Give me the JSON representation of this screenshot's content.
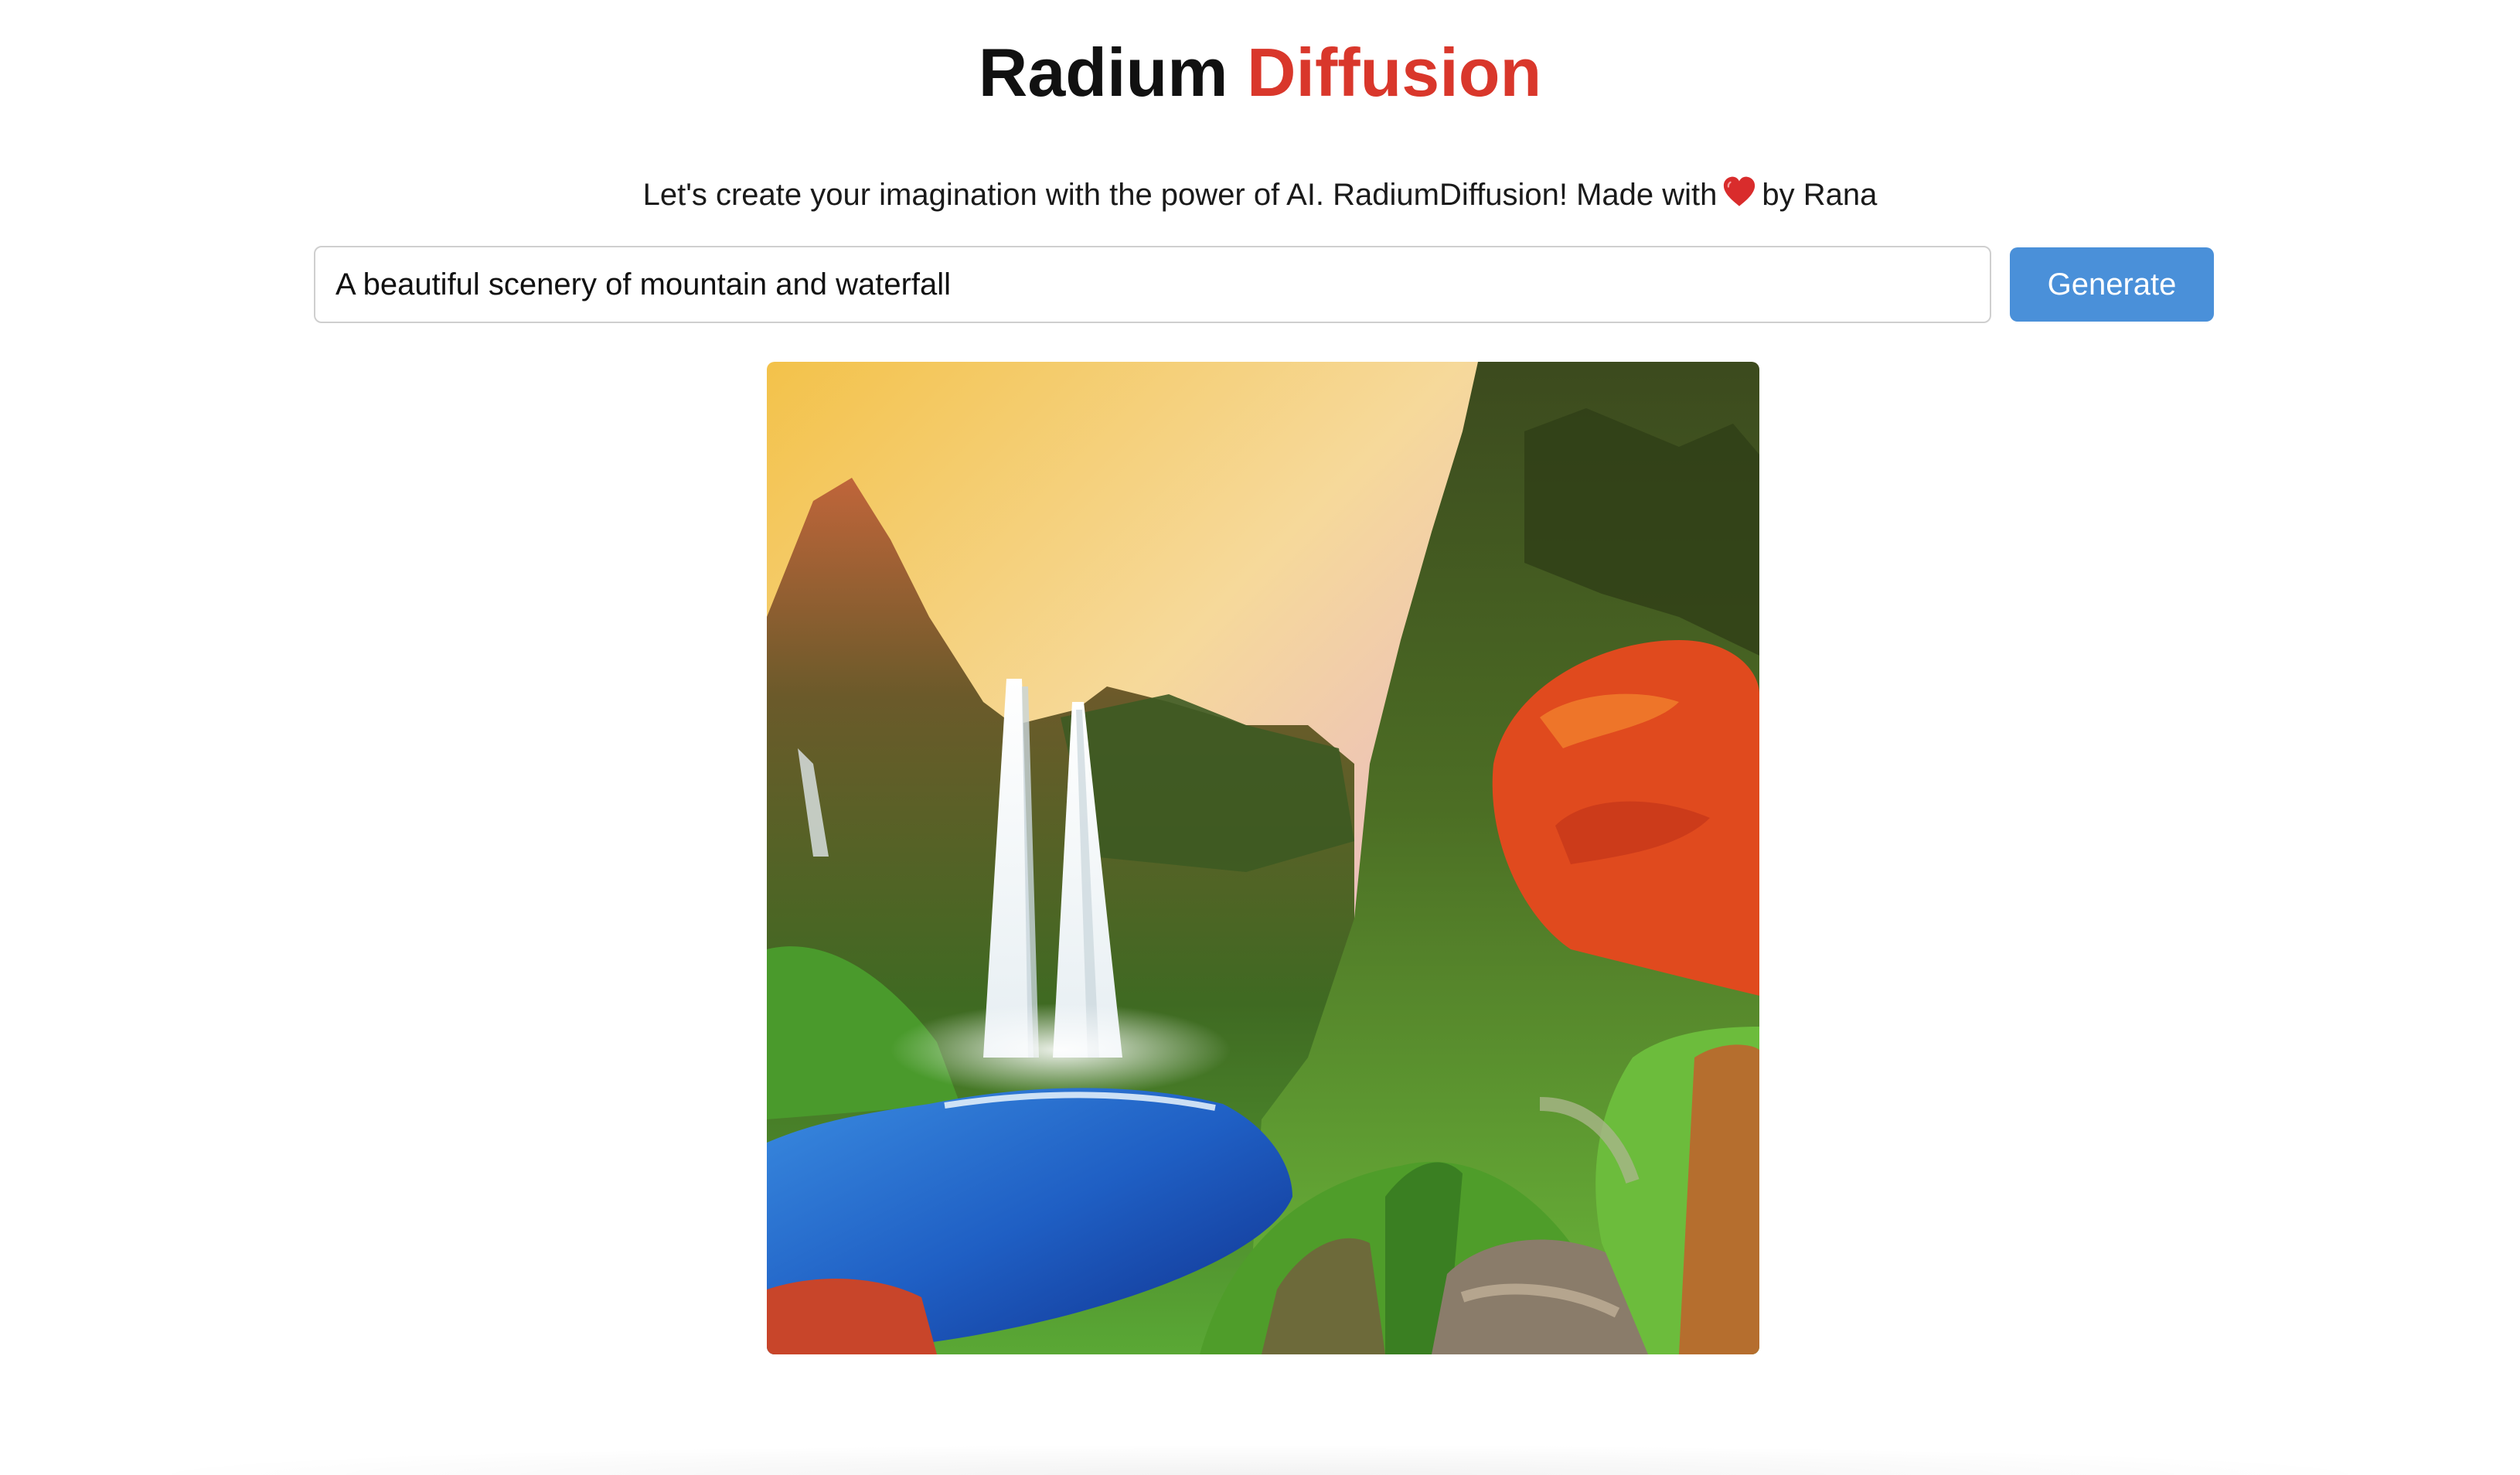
{
  "header": {
    "title_main": "Radium",
    "title_accent": "Diffusion"
  },
  "tagline": {
    "before_icon": "Let's create your imagination with the power of AI. RadiumDiffusion! Made with",
    "icon": "heart-icon",
    "after_icon": "by Rana"
  },
  "prompt": {
    "value": "A beautiful scenery of mountain and waterfall"
  },
  "generate_button": {
    "label": "Generate"
  },
  "colors": {
    "accent": "#d9372b",
    "button": "#4a90d9",
    "heart": "#d92c2c"
  }
}
